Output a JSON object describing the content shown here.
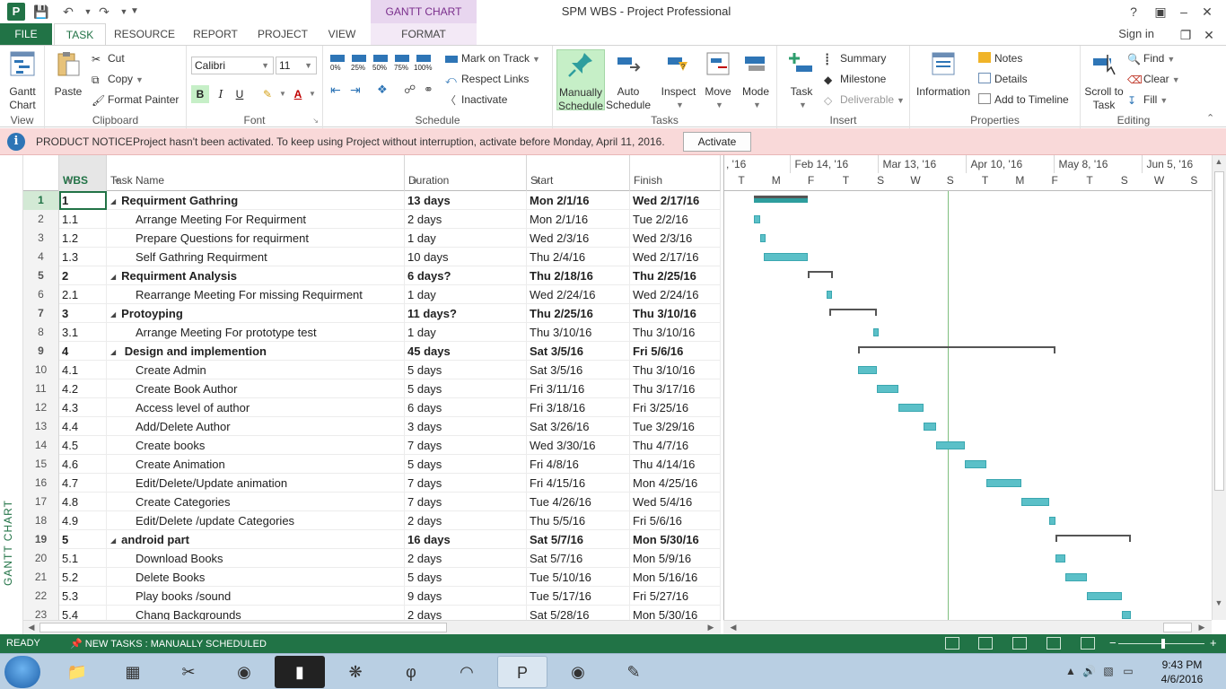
{
  "window": {
    "title": "SPM WBS - Project Professional",
    "tools_title": "GANTT CHART TOOLS",
    "help": "?",
    "minimize": "–",
    "restore": "❐",
    "close": "✕"
  },
  "tabs": {
    "file": "FILE",
    "task": "TASK",
    "resource": "RESOURCE",
    "report": "REPORT",
    "project": "PROJECT",
    "view": "VIEW",
    "format": "FORMAT",
    "signin": "Sign in"
  },
  "ribbon": {
    "view_group": "View",
    "gantt_chart": "Gantt Chart",
    "clipboard_group": "Clipboard",
    "paste": "Paste",
    "cut": "Cut",
    "copy": "Copy",
    "format_painter": "Format Painter",
    "font_group": "Font",
    "font_name": "Calibri",
    "font_size": "11",
    "bold": "B",
    "italic": "I",
    "underline": "U",
    "schedule_group": "Schedule",
    "pct": [
      "0%",
      "25%",
      "50%",
      "75%",
      "100%"
    ],
    "mark_on_track": "Mark on Track",
    "respect_links": "Respect Links",
    "inactivate": "Inactivate",
    "tasks_group": "Tasks",
    "manually_schedule": "Manually Schedule",
    "auto_schedule": "Auto Schedule",
    "inspect": "Inspect",
    "move": "Move",
    "mode": "Mode",
    "insert_group": "Insert",
    "task": "Task",
    "summary": "Summary",
    "milestone": "Milestone",
    "deliverable": "Deliverable",
    "properties_group": "Properties",
    "information": "Information",
    "notes": "Notes",
    "details": "Details",
    "add_to_timeline": "Add to Timeline",
    "editing_group": "Editing",
    "scroll_to_task": "Scroll to Task",
    "find": "Find",
    "clear": "Clear",
    "fill": "Fill"
  },
  "notice": {
    "title": "PRODUCT NOTICE",
    "text": "Project hasn't been activated. To keep using Project without interruption, activate before Monday, April 11, 2016.",
    "button": "Activate"
  },
  "view_label": "GANTT CHART",
  "table": {
    "columns": {
      "wbs": "WBS",
      "task_name": "Task Name",
      "duration": "Duration",
      "start": "Start",
      "finish": "Finish"
    },
    "rows": [
      {
        "id": "1",
        "wbs": "1",
        "name": "Requirment Gathring",
        "duration": "13 days",
        "start": "Mon 2/1/16",
        "finish": "Wed 2/17/16",
        "summary": true
      },
      {
        "id": "2",
        "wbs": "1.1",
        "name": "Arrange Meeting For Requirment",
        "duration": "2 days",
        "start": "Mon 2/1/16",
        "finish": "Tue 2/2/16",
        "summary": false
      },
      {
        "id": "3",
        "wbs": "1.2",
        "name": "Prepare Questions for requirment",
        "duration": "1 day",
        "start": "Wed 2/3/16",
        "finish": "Wed 2/3/16",
        "summary": false
      },
      {
        "id": "4",
        "wbs": "1.3",
        "name": "Self Gathring Requirment",
        "duration": "10 days",
        "start": "Thu 2/4/16",
        "finish": "Wed 2/17/16",
        "summary": false
      },
      {
        "id": "5",
        "wbs": "2",
        "name": "Requirment Analysis",
        "duration": "6 days?",
        "start": "Thu 2/18/16",
        "finish": "Thu 2/25/16",
        "summary": true
      },
      {
        "id": "6",
        "wbs": "2.1",
        "name": "Rearrange Meeting For missing Requirment",
        "duration": "1 day",
        "start": "Wed 2/24/16",
        "finish": "Wed 2/24/16",
        "summary": false
      },
      {
        "id": "7",
        "wbs": "3",
        "name": "Protoyping",
        "duration": "11 days?",
        "start": "Thu 2/25/16",
        "finish": "Thu 3/10/16",
        "summary": true
      },
      {
        "id": "8",
        "wbs": "3.1",
        "name": " Arrange Meeting For prototype test",
        "duration": "1 day",
        "start": "Thu 3/10/16",
        "finish": "Thu 3/10/16",
        "summary": false
      },
      {
        "id": "9",
        "wbs": "4",
        "name": " Design and implemention",
        "duration": "45 days",
        "start": "Sat 3/5/16",
        "finish": "Fri 5/6/16",
        "summary": true
      },
      {
        "id": "10",
        "wbs": "4.1",
        "name": "Create Admin",
        "duration": "5 days",
        "start": "Sat 3/5/16",
        "finish": "Thu 3/10/16",
        "summary": false
      },
      {
        "id": "11",
        "wbs": "4.2",
        "name": "Create Book Author",
        "duration": "5 days",
        "start": "Fri 3/11/16",
        "finish": "Thu 3/17/16",
        "summary": false
      },
      {
        "id": "12",
        "wbs": "4.3",
        "name": "Access level of author",
        "duration": "6 days",
        "start": "Fri 3/18/16",
        "finish": "Fri 3/25/16",
        "summary": false
      },
      {
        "id": "13",
        "wbs": "4.4",
        "name": "Add/Delete Author",
        "duration": "3 days",
        "start": "Sat 3/26/16",
        "finish": "Tue 3/29/16",
        "summary": false
      },
      {
        "id": "14",
        "wbs": "4.5",
        "name": "Create books",
        "duration": "7 days",
        "start": "Wed 3/30/16",
        "finish": "Thu 4/7/16",
        "summary": false
      },
      {
        "id": "15",
        "wbs": "4.6",
        "name": "Create Animation",
        "duration": "5 days",
        "start": "Fri 4/8/16",
        "finish": "Thu 4/14/16",
        "summary": false
      },
      {
        "id": "16",
        "wbs": "4.7",
        "name": " Edit/Delete/Update animation",
        "duration": "7 days",
        "start": "Fri 4/15/16",
        "finish": "Mon 4/25/16",
        "summary": false
      },
      {
        "id": "17",
        "wbs": "4.8",
        "name": "Create Categories",
        "duration": "7 days",
        "start": "Tue 4/26/16",
        "finish": "Wed 5/4/16",
        "summary": false
      },
      {
        "id": "18",
        "wbs": "4.9",
        "name": "Edit/Delete /update Categories",
        "duration": "2 days",
        "start": "Thu 5/5/16",
        "finish": "Fri 5/6/16",
        "summary": false
      },
      {
        "id": "19",
        "wbs": "5",
        "name": "android part",
        "duration": "16 days",
        "start": "Sat 5/7/16",
        "finish": "Mon 5/30/16",
        "summary": true
      },
      {
        "id": "20",
        "wbs": "5.1",
        "name": "Download Books",
        "duration": "2 days",
        "start": "Sat 5/7/16",
        "finish": "Mon 5/9/16",
        "summary": false
      },
      {
        "id": "21",
        "wbs": "5.2",
        "name": "Delete Books",
        "duration": "5 days",
        "start": "Tue 5/10/16",
        "finish": "Mon 5/16/16",
        "summary": false
      },
      {
        "id": "22",
        "wbs": "5.3",
        "name": "Play books /sound",
        "duration": "9 days",
        "start": "Tue 5/17/16",
        "finish": "Fri 5/27/16",
        "summary": false
      },
      {
        "id": "23",
        "wbs": "5.4",
        "name": "Chang Backgrounds",
        "duration": "2 days",
        "start": "Sat 5/28/16",
        "finish": "Mon 5/30/16",
        "summary": false
      }
    ]
  },
  "gantt": {
    "months": [
      ", '16",
      "Feb 14, '16",
      "Mar 13, '16",
      "Apr 10, '16",
      "May 8, '16",
      "Jun 5, '16"
    ],
    "days": [
      "T",
      "M",
      "F",
      "T",
      "S",
      "W",
      "S",
      "T",
      "M",
      "F",
      "T",
      "S",
      "W",
      "S"
    ],
    "timeline_start": "2016-01-26",
    "status_date": "2016-04-06",
    "bar_color": "#5bc0c8",
    "summary_color": "#555555"
  },
  "status": {
    "ready": "READY",
    "mode": "NEW TASKS : MANUALLY SCHEDULED",
    "accent": "#217346"
  },
  "taskbar": {
    "time": "9:43 PM",
    "date": "4/6/2016",
    "apps": [
      "explorer-icon",
      "calculator-icon",
      "snipping-icon",
      "chrome-icon",
      "cmd-icon",
      "app-tree-icon",
      "php-icon",
      "app-orange-icon",
      "project-icon",
      "chrome-icon",
      "paint-icon"
    ]
  }
}
